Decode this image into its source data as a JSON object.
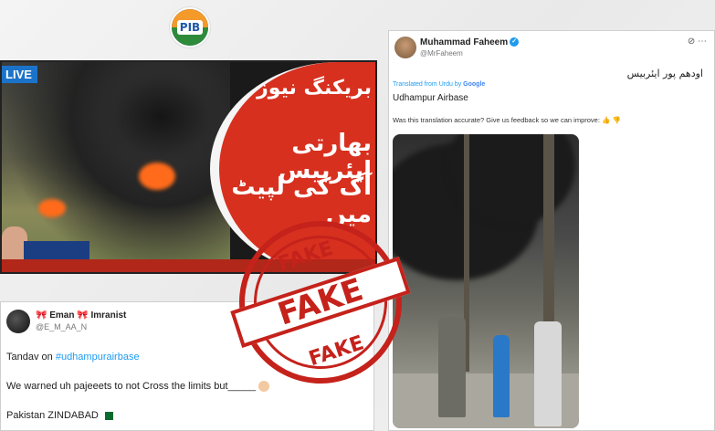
{
  "pib_logo": {
    "text": "PIB"
  },
  "tv_panel": {
    "live_label": "LIVE",
    "headline_line1": "بریکنگ نیوز",
    "headline_line2": "بھارتی ایئربیس",
    "headline_line3": "آگ کی لپیٹ میں"
  },
  "tweet_left": {
    "name": "Eman",
    "name_suffix": "Imranist",
    "handle": "@E_M_AA_N",
    "line1_prefix": "Tandav on ",
    "line1_hashtag": "#udhampurairbase",
    "line2": "We warned uh pajeeets to not Cross the limits but_____",
    "line3": "Pakistan ZINDABAD"
  },
  "tweet_right": {
    "name": "Muhammad Faheem",
    "handle": "@MrFaheem",
    "urdu_text": "اودھم پور ایئربیس",
    "translated_label": "Translated from Urdu by",
    "translated_provider": "Google",
    "translation": "Udhampur Airbase",
    "feedback": "Was this translation accurate? Give us feedback so we can improve:"
  },
  "stamp": {
    "top_word": "FAKE",
    "center_word": "FAKE",
    "bottom_word": "FAKE",
    "color": "#c4221b"
  }
}
